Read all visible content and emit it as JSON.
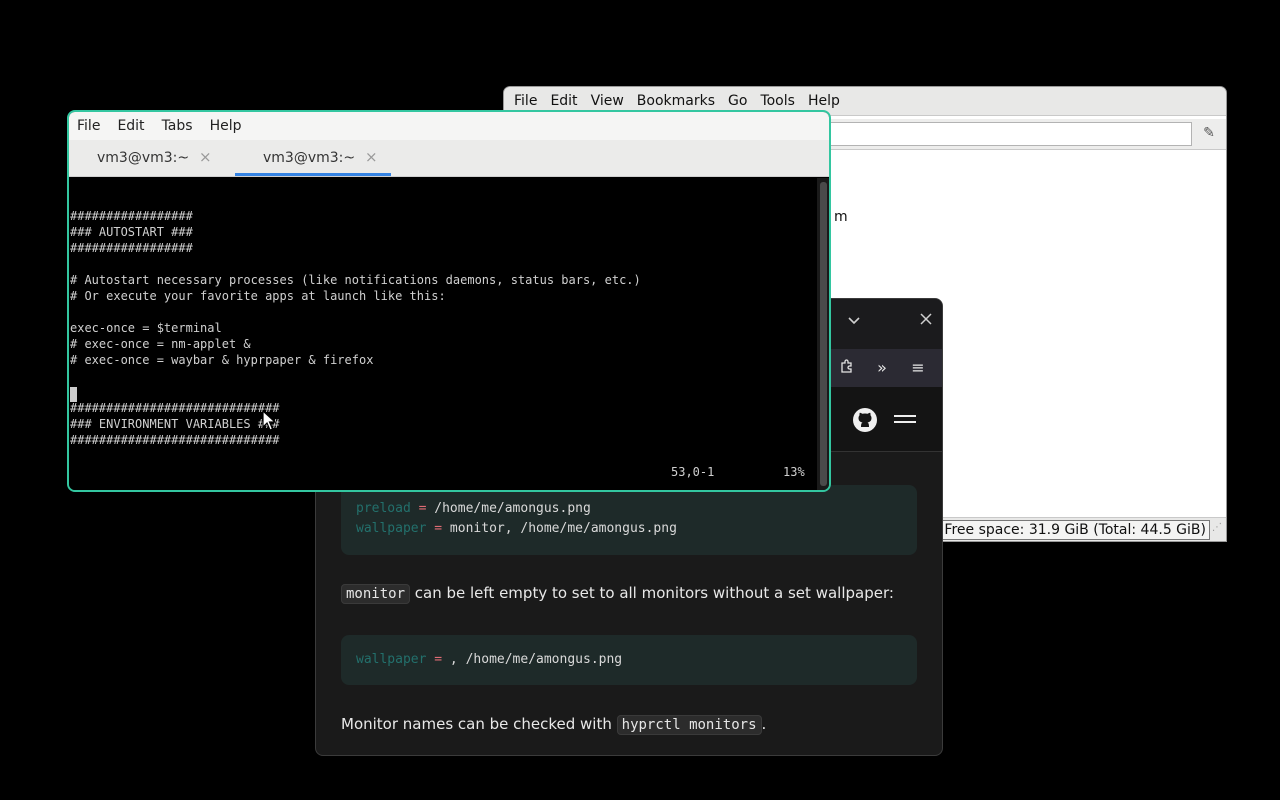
{
  "file_manager": {
    "menu": [
      "File",
      "Edit",
      "View",
      "Bookmarks",
      "Go",
      "Tools",
      "Help"
    ],
    "visible_fragment": "m",
    "status_free_space": "Free space: 31.9 GiB (Total: 44.5 GiB)"
  },
  "browser": {
    "code1": {
      "line1": {
        "key": "preload",
        "op": "=",
        "value": " /home/me/amongus.png"
      },
      "line2": {
        "key": "wallpaper",
        "op": "=",
        "value": " monitor, /home/me/amongus.png"
      }
    },
    "para1": {
      "code": "monitor",
      "text": " can be left empty to set to all monitors without a set wallpaper:"
    },
    "code2": {
      "line1": {
        "key": "wallpaper",
        "op": "=",
        "value": " , /home/me/amongus.png"
      }
    },
    "para2": {
      "text": "Monitor names can be checked with ",
      "code": "hyprctl monitors",
      "suffix": "."
    }
  },
  "terminal": {
    "menu": [
      "File",
      "Edit",
      "Tabs",
      "Help"
    ],
    "tabs": [
      {
        "label": "vm3@vm3:~",
        "active": false
      },
      {
        "label": "vm3@vm3:~",
        "active": true
      }
    ],
    "lines": [
      "#################",
      "### AUTOSTART ###",
      "#################",
      "",
      "# Autostart necessary processes (like notifications daemons, status bars, etc.)",
      "# Or execute your favorite apps at launch like this:",
      "",
      "exec-once = $terminal",
      "# exec-once = nm-applet &",
      "# exec-once = waybar & hyprpaper & firefox",
      "",
      "",
      "#############################",
      "### ENVIRONMENT VARIABLES ###",
      "#############################"
    ],
    "cursor_position": "53,0-1",
    "scroll_percent": "13%"
  }
}
